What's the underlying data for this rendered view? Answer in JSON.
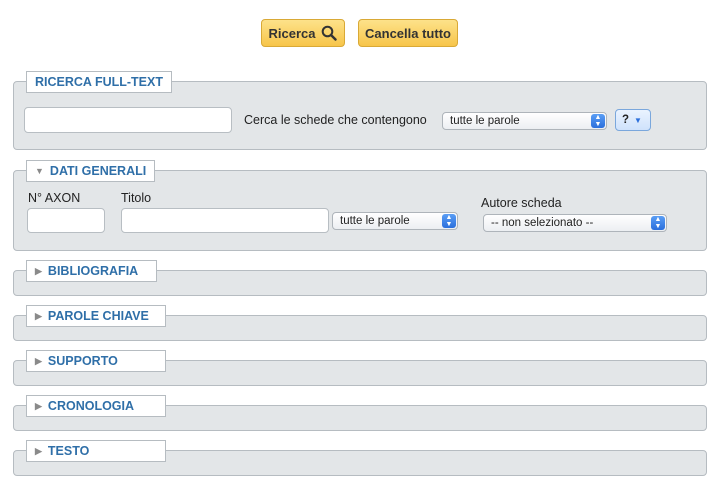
{
  "toolbar": {
    "search_label": "Ricerca",
    "clear_label": "Cancella tutto"
  },
  "fulltext": {
    "title": "RICERCA FULL-TEXT",
    "input_value": "",
    "search_prompt": "Cerca le schede che contengono",
    "mode_select": "tutte le parole",
    "help_label": "?"
  },
  "dati_generali": {
    "title": "DATI GENERALI",
    "axon_label": "N° AXON",
    "axon_value": "",
    "titolo_label": "Titolo",
    "titolo_value": "",
    "titolo_mode": "tutte le parole",
    "autore_label": "Autore scheda",
    "autore_select": "-- non selezionato --"
  },
  "sections": [
    {
      "title": "BIBLIOGRAFIA"
    },
    {
      "title": "PAROLE CHIAVE"
    },
    {
      "title": "SUPPORTO"
    },
    {
      "title": "CRONOLOGIA"
    },
    {
      "title": "TESTO"
    }
  ],
  "icons": {
    "search": "magnifier-icon",
    "collapse": "triangle-down-icon",
    "expand": "triangle-right-icon"
  }
}
